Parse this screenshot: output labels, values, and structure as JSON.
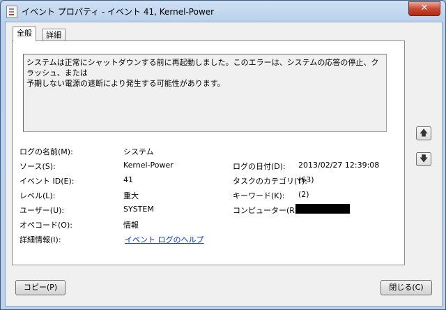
{
  "window": {
    "title": "イベント プロパティ - イベント 41, Kernel-Power",
    "close_glyph": "✕"
  },
  "tabs": [
    {
      "label": "全般"
    },
    {
      "label": "詳細"
    }
  ],
  "description": {
    "line1": "システムは正常にシャットダウンする前に再起動しました。このエラーは、システムの応答の停止、クラッシュ、または",
    "line2": "予期しない電源の遮断により発生する可能性があります。"
  },
  "fields": {
    "log_name_label": "ログの名前(M):",
    "log_name_value": "システム",
    "source_label": "ソース(S):",
    "source_value": "Kernel-Power",
    "logged_label": "ログの日付(D):",
    "logged_value": "2013/02/27 12:39:08",
    "event_id_label": "イベント ID(E):",
    "event_id_value": "41",
    "task_category_label": "タスクのカテゴリ(Y):",
    "task_category_value": "(63)",
    "level_label": "レベル(L):",
    "level_value": "重大",
    "keywords_label": "キーワード(K):",
    "keywords_value": "(2)",
    "user_label": "ユーザー(U):",
    "user_value": "SYSTEM",
    "computer_label": "コンピューター(R):",
    "opcode_label": "オペコード(O):",
    "opcode_value": "情報",
    "more_info_label": "詳細情報(I):",
    "more_info_link": "イベント ログのヘルプ"
  },
  "side_buttons": {
    "up_glyph": "🡅",
    "down_glyph": "🡇"
  },
  "footer": {
    "copy_label": "コピー(P)",
    "close_label": "閉じる(C)"
  }
}
